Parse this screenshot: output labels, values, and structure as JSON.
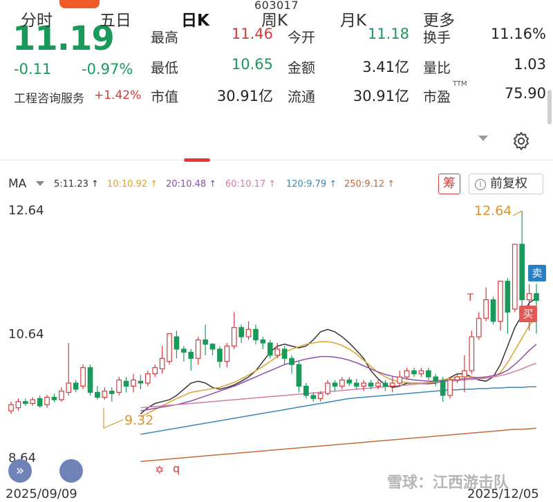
{
  "header": {
    "stock_code": "603017"
  },
  "quote": {
    "price": "11.19",
    "change_abs": "-0.11",
    "change_pct": "-0.97%",
    "sector_name": "工程咨询服务",
    "sector_pct": "+1.42%",
    "fields": [
      {
        "label": "最高",
        "value": "11.46",
        "color": "#d23a3a"
      },
      {
        "label": "今开",
        "value": "11.18",
        "color": "#1a9a5a"
      },
      {
        "label": "换手",
        "value": "11.16%",
        "color": "#222222"
      },
      {
        "label": "最低",
        "value": "10.65",
        "color": "#1a9a5a"
      },
      {
        "label": "金额",
        "value": "3.41亿",
        "color": "#222222"
      },
      {
        "label": "量比",
        "value": "1.03",
        "color": "#222222"
      },
      {
        "label": "市值",
        "value": "30.91亿",
        "color": "#222222"
      },
      {
        "label": "流通",
        "value": "30.91亿",
        "color": "#222222"
      },
      {
        "label": "市盈",
        "value": "75.90",
        "color": "#222222"
      }
    ],
    "ttm_label": "TTM"
  },
  "tabs": [
    {
      "label": "分时"
    },
    {
      "label": "五日"
    },
    {
      "label": "日K"
    },
    {
      "label": "周K"
    },
    {
      "label": "月K"
    },
    {
      "label": "更多"
    }
  ],
  "active_tab": "日K",
  "ma_bar": {
    "title": "MA",
    "items": [
      {
        "text": "5:11.23 ↑",
        "color": "#333333"
      },
      {
        "text": "10:10.92 ↑",
        "color": "#d9a32c"
      },
      {
        "text": "20:10.48 ↑",
        "color": "#8a4fa8"
      },
      {
        "text": "60:10.17 ↑",
        "color": "#d77aa8"
      },
      {
        "text": "120:9.79 ↑",
        "color": "#3a86b8"
      },
      {
        "text": "250:9.12 ↑",
        "color": "#c26a3a"
      }
    ],
    "chip_label": "筹",
    "adjust_label": "前复权",
    "info_glyph": "i"
  },
  "chart_labels": {
    "y_top": "12.64",
    "y_mid": "10.64",
    "y_bottom": "8.64",
    "x_start": "2025/09/09",
    "x_end": "2025/12/05",
    "max_label": "12.64",
    "min_label": "9.32",
    "sell_badge": "卖",
    "buy_badge": "买",
    "t_mark": "T",
    "event_mark_1": "✡",
    "event_mark_2": "q",
    "nav_glyph": "»"
  },
  "watermark": "雪球：江西游击队",
  "chart_data": {
    "type": "candlestick",
    "ylim": [
      8.64,
      12.64
    ],
    "y_ticks": [
      "12.64",
      "10.64",
      "8.64"
    ],
    "x_range": [
      "2025/09/09",
      "2025/12/05"
    ],
    "up_color": "#d23a3a",
    "down_color": "#1a9a5a",
    "candles": [
      [
        9.4,
        9.5,
        9.35,
        9.55
      ],
      [
        9.45,
        9.55,
        9.4,
        9.6
      ],
      [
        9.55,
        9.52,
        9.48,
        9.6
      ],
      [
        9.52,
        9.58,
        9.48,
        9.62
      ],
      [
        9.6,
        9.48,
        9.45,
        9.65
      ],
      [
        9.5,
        9.62,
        9.45,
        9.66
      ],
      [
        9.62,
        9.58,
        9.54,
        9.68
      ],
      [
        9.58,
        9.72,
        9.55,
        9.78
      ],
      [
        9.7,
        9.85,
        9.65,
        10.5
      ],
      [
        9.85,
        9.75,
        9.7,
        9.9
      ],
      [
        9.8,
        10.1,
        9.75,
        10.15
      ],
      [
        10.1,
        9.7,
        9.65,
        10.15
      ],
      [
        9.7,
        9.62,
        9.58,
        9.8
      ],
      [
        9.62,
        9.72,
        9.58,
        9.78
      ],
      [
        9.72,
        9.68,
        9.55,
        9.78
      ],
      [
        9.7,
        9.9,
        9.65,
        9.95
      ],
      [
        9.88,
        9.8,
        9.7,
        9.95
      ],
      [
        9.8,
        9.9,
        9.7,
        10.0
      ],
      [
        9.88,
        9.85,
        9.75,
        9.98
      ],
      [
        9.85,
        10.0,
        9.8,
        10.05
      ],
      [
        10.0,
        10.1,
        9.95,
        10.15
      ],
      [
        10.08,
        10.25,
        10.0,
        10.45
      ],
      [
        10.2,
        10.65,
        10.15,
        10.65
      ],
      [
        10.6,
        10.4,
        10.25,
        10.7
      ],
      [
        10.4,
        10.35,
        10.2,
        10.45
      ],
      [
        10.35,
        10.25,
        10.05,
        10.4
      ],
      [
        10.25,
        10.55,
        10.15,
        10.6
      ],
      [
        10.55,
        10.48,
        10.3,
        10.8
      ],
      [
        10.48,
        10.4,
        10.3,
        10.5
      ],
      [
        10.4,
        10.2,
        10.1,
        10.45
      ],
      [
        10.2,
        10.45,
        10.1,
        10.5
      ],
      [
        10.45,
        10.75,
        10.4,
        11.0
      ],
      [
        10.75,
        10.6,
        10.5,
        10.8
      ],
      [
        10.6,
        10.72,
        10.55,
        10.85
      ],
      [
        10.72,
        10.55,
        10.48,
        10.8
      ],
      [
        10.55,
        10.5,
        10.4,
        10.6
      ],
      [
        10.5,
        10.3,
        10.25,
        10.55
      ],
      [
        10.3,
        10.4,
        10.25,
        10.5
      ],
      [
        10.4,
        10.25,
        10.15,
        10.45
      ],
      [
        10.25,
        10.15,
        10.0,
        10.3
      ],
      [
        10.15,
        9.8,
        9.7,
        10.2
      ],
      [
        9.8,
        9.65,
        9.6,
        9.85
      ],
      [
        9.65,
        9.6,
        9.55,
        9.7
      ],
      [
        9.6,
        9.68,
        9.55,
        9.72
      ],
      [
        9.68,
        9.85,
        9.65,
        9.9
      ],
      [
        9.85,
        9.8,
        9.72,
        9.9
      ],
      [
        9.8,
        9.9,
        9.75,
        9.95
      ],
      [
        9.9,
        9.85,
        9.8,
        9.95
      ],
      [
        9.85,
        9.8,
        9.75,
        9.92
      ],
      [
        9.8,
        9.85,
        9.72,
        9.9
      ],
      [
        9.85,
        9.8,
        9.75,
        9.9
      ],
      [
        9.8,
        9.85,
        9.75,
        9.9
      ],
      [
        9.85,
        9.8,
        9.72,
        9.9
      ],
      [
        9.8,
        9.85,
        9.7,
        9.95
      ],
      [
        9.85,
        9.95,
        9.8,
        10.05
      ],
      [
        9.95,
        10.05,
        9.9,
        10.1
      ],
      [
        10.05,
        10.0,
        9.95,
        10.1
      ],
      [
        10.0,
        10.05,
        9.95,
        10.1
      ],
      [
        10.05,
        9.95,
        9.9,
        10.1
      ],
      [
        9.95,
        9.88,
        9.8,
        10.0
      ],
      [
        9.88,
        9.65,
        9.55,
        9.95
      ],
      [
        9.65,
        9.9,
        9.6,
        9.95
      ],
      [
        9.9,
        9.95,
        9.85,
        10.0
      ],
      [
        9.95,
        10.05,
        9.7,
        10.3
      ],
      [
        10.05,
        10.6,
        10.0,
        10.7
      ],
      [
        10.6,
        10.9,
        10.55,
        11.0
      ],
      [
        10.9,
        11.2,
        10.85,
        11.4
      ],
      [
        11.2,
        10.85,
        10.8,
        11.25
      ],
      [
        10.85,
        11.5,
        10.7,
        11.5
      ],
      [
        11.5,
        11.0,
        10.65,
        11.55
      ],
      [
        11.05,
        12.1,
        11.0,
        12.1
      ],
      [
        12.1,
        11.2,
        11.1,
        12.64
      ],
      [
        11.2,
        11.3,
        10.7,
        11.45
      ],
      [
        11.3,
        11.19,
        10.65,
        11.46
      ]
    ],
    "ma_series": [
      {
        "name": "MA5",
        "color": "#333333",
        "values": [
          9.35,
          9.45,
          9.52,
          9.55,
          9.58,
          9.65,
          9.75,
          9.85,
          9.88,
          9.85,
          9.78,
          9.75,
          9.78,
          9.82,
          9.88,
          9.95,
          10.05,
          10.2,
          10.35,
          10.45,
          10.48,
          10.45,
          10.42,
          10.45,
          10.55,
          10.68,
          10.72,
          10.68,
          10.6,
          10.5,
          10.38,
          10.25,
          10.05,
          9.92,
          9.82,
          9.78,
          9.8,
          9.85,
          9.85,
          9.84,
          9.84,
          9.85,
          9.88,
          9.94,
          10.0,
          10.0,
          9.95,
          9.9,
          9.88,
          9.95,
          10.15,
          10.45,
          10.75,
          10.95,
          11.15,
          11.23
        ]
      },
      {
        "name": "MA10",
        "color": "#d9a32c",
        "values": [
          9.3,
          9.36,
          9.42,
          9.48,
          9.54,
          9.6,
          9.65,
          9.7,
          9.72,
          9.74,
          9.76,
          9.78,
          9.82,
          9.86,
          9.92,
          9.98,
          10.05,
          10.12,
          10.2,
          10.28,
          10.35,
          10.4,
          10.44,
          10.48,
          10.5,
          10.52,
          10.52,
          10.5,
          10.46,
          10.4,
          10.32,
          10.22,
          10.12,
          10.02,
          9.95,
          9.9,
          9.87,
          9.86,
          9.85,
          9.85,
          9.86,
          9.88,
          9.9,
          9.93,
          9.95,
          9.96,
          9.95,
          9.94,
          9.93,
          9.95,
          10.02,
          10.18,
          10.38,
          10.58,
          10.78,
          10.92
        ]
      },
      {
        "name": "MA20",
        "color": "#8a4fa8",
        "values": [
          9.4,
          9.42,
          9.44,
          9.46,
          9.48,
          9.5,
          9.53,
          9.56,
          9.6,
          9.64,
          9.68,
          9.72,
          9.76,
          9.8,
          9.85,
          9.9,
          9.95,
          10.0,
          10.05,
          10.1,
          10.15,
          10.18,
          10.21,
          10.24,
          10.26,
          10.28,
          10.28,
          10.27,
          10.25,
          10.22,
          10.18,
          10.13,
          10.08,
          10.03,
          9.99,
          9.96,
          9.94,
          9.92,
          9.9,
          9.89,
          9.88,
          9.88,
          9.89,
          9.9,
          9.91,
          9.92,
          9.93,
          9.94,
          9.95,
          9.97,
          10.0,
          10.06,
          10.15,
          10.26,
          10.38,
          10.48
        ]
      },
      {
        "name": "MA60",
        "color": "#d77aa8",
        "values": [
          9.45,
          9.46,
          9.47,
          9.48,
          9.49,
          9.5,
          9.51,
          9.52,
          9.53,
          9.54,
          9.55,
          9.56,
          9.57,
          9.58,
          9.59,
          9.6,
          9.61,
          9.62,
          9.63,
          9.64,
          9.65,
          9.66,
          9.67,
          9.68,
          9.69,
          9.7,
          9.71,
          9.72,
          9.73,
          9.74,
          9.75,
          9.76,
          9.77,
          9.78,
          9.79,
          9.8,
          9.81,
          9.82,
          9.83,
          9.84,
          9.85,
          9.86,
          9.87,
          9.88,
          9.89,
          9.9,
          9.91,
          9.92,
          9.93,
          9.95,
          9.97,
          10.0,
          10.04,
          10.08,
          10.13,
          10.17
        ]
      },
      {
        "name": "MA120",
        "color": "#3a86b8",
        "values": [
          9.02,
          9.04,
          9.06,
          9.08,
          9.1,
          9.12,
          9.14,
          9.16,
          9.18,
          9.2,
          9.22,
          9.24,
          9.26,
          9.28,
          9.3,
          9.32,
          9.34,
          9.36,
          9.38,
          9.4,
          9.42,
          9.44,
          9.46,
          9.48,
          9.5,
          9.52,
          9.54,
          9.56,
          9.58,
          9.6,
          9.61,
          9.62,
          9.63,
          9.64,
          9.65,
          9.66,
          9.67,
          9.68,
          9.69,
          9.7,
          9.71,
          9.72,
          9.73,
          9.74,
          9.74,
          9.75,
          9.75,
          9.76,
          9.76,
          9.77,
          9.77,
          9.78,
          9.78,
          9.78,
          9.79,
          9.79
        ]
      },
      {
        "name": "MA250",
        "color": "#c26a3a",
        "values": [
          8.58,
          8.59,
          8.6,
          8.61,
          8.62,
          8.63,
          8.64,
          8.65,
          8.66,
          8.67,
          8.68,
          8.69,
          8.7,
          8.71,
          8.72,
          8.73,
          8.74,
          8.75,
          8.76,
          8.77,
          8.78,
          8.79,
          8.8,
          8.81,
          8.82,
          8.83,
          8.84,
          8.85,
          8.86,
          8.87,
          8.88,
          8.89,
          8.9,
          8.91,
          8.92,
          8.93,
          8.94,
          8.95,
          8.96,
          8.97,
          8.98,
          8.99,
          9.0,
          9.01,
          9.02,
          9.03,
          9.04,
          9.05,
          9.06,
          9.07,
          9.08,
          9.09,
          9.1,
          9.1,
          9.11,
          9.12
        ]
      }
    ]
  }
}
